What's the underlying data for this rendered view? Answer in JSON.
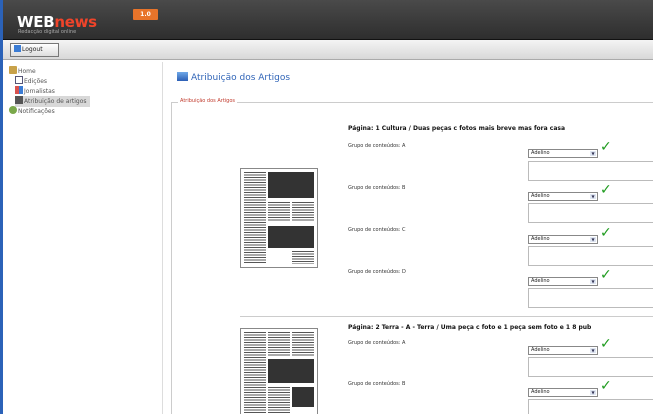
{
  "app": {
    "logo_main": "WEB",
    "logo_accent": "news",
    "tagline": "Redacção digital online",
    "version": "1.0"
  },
  "toolbar": {
    "logout_label": "Logout"
  },
  "sidebar": {
    "items": [
      {
        "label": "Home",
        "icon": "home-icon",
        "level": 0
      },
      {
        "label": "Edições",
        "icon": "document-icon",
        "level": 1
      },
      {
        "label": "Jornalistas",
        "icon": "users-icon",
        "level": 1
      },
      {
        "label": "Atribuição de artigos",
        "icon": "assign-icon",
        "level": 1,
        "selected": true
      },
      {
        "label": "Notificações",
        "icon": "notification-icon",
        "level": 0
      }
    ]
  },
  "main": {
    "title": "Atribuição dos Artigos",
    "section_legend": "Atribuição dos Artigos",
    "pages": [
      {
        "title": "Página: 1   Cultura / Duas peças c fotos mais breve mas fora casa",
        "groups": [
          {
            "label": "Grupo de conteúdos: A",
            "value": "Adelino"
          },
          {
            "label": "Grupo de conteúdos: B",
            "value": "Adelino"
          },
          {
            "label": "Grupo de conteúdos: C",
            "value": "Adelino"
          },
          {
            "label": "Grupo de conteúdos: D",
            "value": "Adelino"
          }
        ]
      },
      {
        "title": "Página: 2   Terra - A - Terra / Uma peça c foto e 1 peça sem foto e 1 8 pub",
        "groups": [
          {
            "label": "Grupo de conteúdos: A",
            "value": "Adelino"
          },
          {
            "label": "Grupo de conteúdos: B",
            "value": "Adelino"
          }
        ]
      }
    ]
  },
  "colors": {
    "accent": "#3266b8",
    "logo_accent": "#f0442a",
    "check": "#1e9b1e",
    "version_badge": "#e8742a"
  }
}
